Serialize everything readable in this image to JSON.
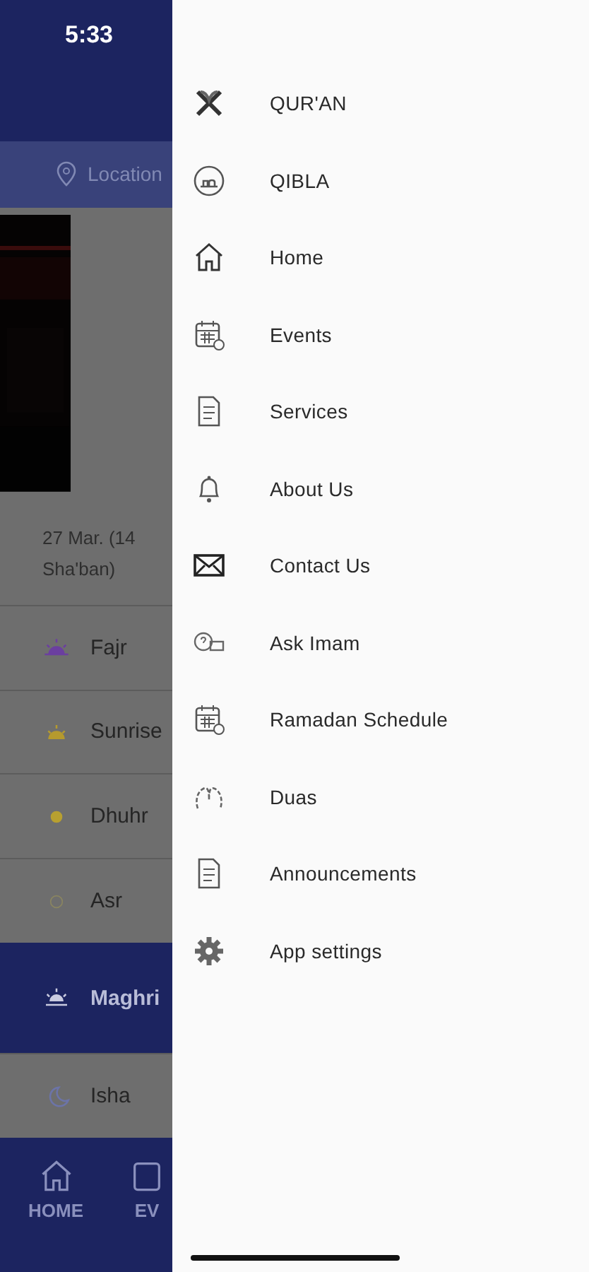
{
  "status_bar": {
    "time": "5:33"
  },
  "background": {
    "location": "Location",
    "date": "27 Mar. (14 Sha'ban)",
    "prayers": [
      {
        "name": "Fajr",
        "selected": false
      },
      {
        "name": "Sunrise",
        "selected": false
      },
      {
        "name": "Dhuhr",
        "selected": false
      },
      {
        "name": "Asr",
        "selected": false
      },
      {
        "name": "Maghri",
        "selected": true
      },
      {
        "name": "Isha",
        "selected": false
      }
    ],
    "bottom_nav": [
      {
        "label": "HOME"
      },
      {
        "label": "EV"
      }
    ]
  },
  "drawer": {
    "items": [
      {
        "label": "QUR'AN"
      },
      {
        "label": "QIBLA"
      },
      {
        "label": "Home"
      },
      {
        "label": "Events"
      },
      {
        "label": "Services"
      },
      {
        "label": "About Us"
      },
      {
        "label": "Contact Us"
      },
      {
        "label": "Ask Imam"
      },
      {
        "label": "Ramadan Schedule"
      },
      {
        "label": "Duas"
      },
      {
        "label": "Announcements"
      },
      {
        "label": "App settings"
      }
    ]
  }
}
